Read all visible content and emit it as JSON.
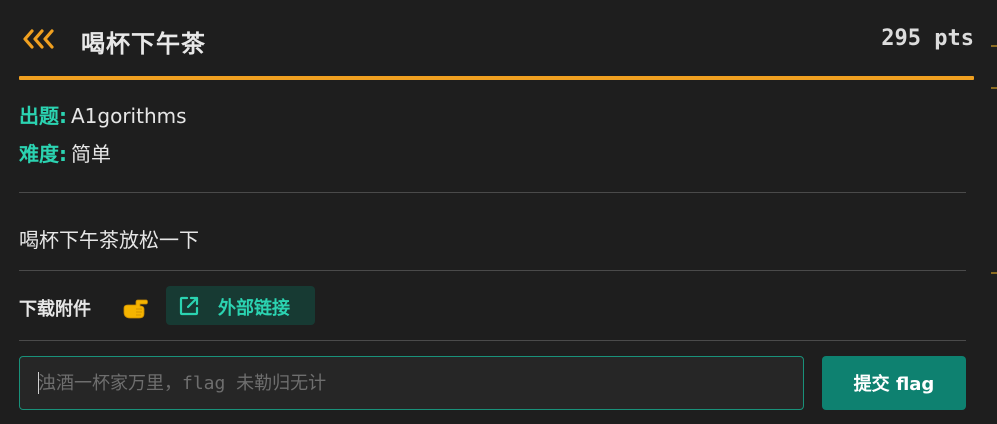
{
  "header": {
    "title": "喝杯下午茶",
    "points": "295 pts"
  },
  "meta": {
    "author_key": "出题:",
    "author_value": "A1gorithms",
    "difficulty_key": "难度:",
    "difficulty_value": "简单"
  },
  "description": "喝杯下午茶放松一下",
  "attachments": {
    "label": "下载附件",
    "external_link_label": "外部链接"
  },
  "flag_form": {
    "placeholder": "浊酒一杯家万里，flag 未勒归无计",
    "value": "",
    "submit_label": "提交 flag"
  },
  "icons": {
    "back": "triple-chevron-left-icon",
    "hand": "pointing-hand-icon",
    "external": "external-link-icon"
  },
  "colors": {
    "accent_orange": "#f0a020",
    "accent_teal": "#2bd3b1",
    "button_teal": "#0e8170",
    "background": "#1e1e1e"
  }
}
